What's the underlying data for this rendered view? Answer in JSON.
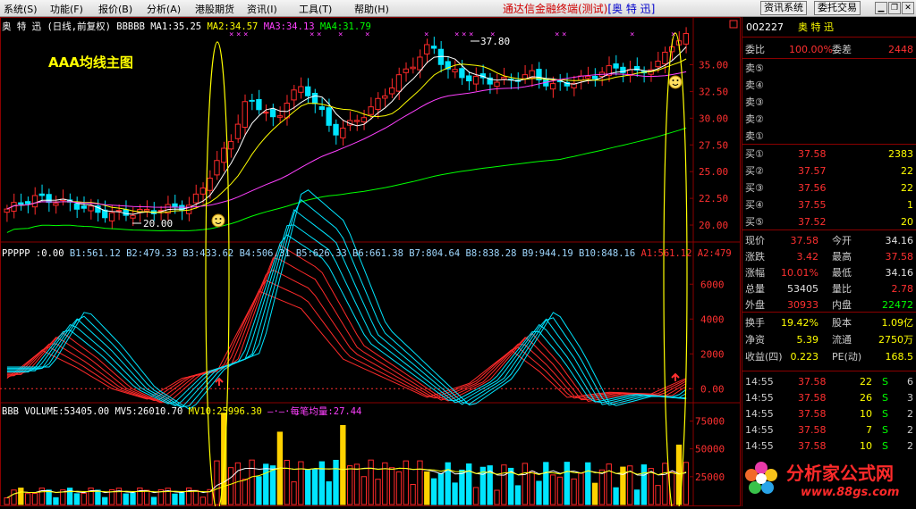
{
  "menubar": {
    "items": [
      "系统(S)",
      "功能(F)",
      "报价(B)",
      "分析(A)",
      "港股期货",
      "资讯(I)",
      "工具(T)",
      "帮助(H)"
    ],
    "app_title": "通达信金融终端(测试)",
    "app_stock": "[奥 特 迅]",
    "btn_news": "资讯系统",
    "btn_trade": "委托交易"
  },
  "main_chart": {
    "header": {
      "name": "奥 特 迅",
      "period": "(日线,前复权)",
      "indicator": "BBBBB",
      "ma1": "MA1:35.25",
      "ma2": "MA2:34.57",
      "ma3": "MA3:34.13",
      "ma4": "MA4:31.79"
    },
    "label": "AAA均线主图",
    "y_ticks": [
      "35.00",
      "32.50",
      "30.00",
      "27.50",
      "25.00",
      "22.50",
      "20.00"
    ],
    "high_label": "37.80",
    "low_label": "20.00",
    "colors": {
      "up": "#ff2a2a",
      "down": "#00e5ff",
      "ma1": "#ffffff",
      "ma2": "#ffff00",
      "ma3": "#ff40ff",
      "ma4": "#00ff00"
    }
  },
  "mid_chart": {
    "header": {
      "title": "PPPPP :0.00",
      "b1": "B1:561.12",
      "b2": "B2:479.33",
      "b3": "B3:433.62",
      "b4": "B4:506.31",
      "b5": "B5:626.33",
      "b6": "B6:661.38",
      "b7": "B7:804.64",
      "b8": "B8:838.28",
      "b9": "B9:944.19",
      "b10": "B10:848.16",
      "a1": "A1:561.12",
      "a2": "A2:479"
    },
    "y_ticks": [
      "6000",
      "4000",
      "2000",
      "0.00"
    ]
  },
  "vol_chart": {
    "header": {
      "title": "BBB VOLUME:53405.00",
      "mv5": "MV5:26010.70",
      "mv10": "MV10:25996.30",
      "avg": "每笔均量:27.44"
    },
    "y_ticks": [
      "75000",
      "50000",
      "25000"
    ]
  },
  "quote": {
    "code": "002227",
    "name": "奥 特 迅",
    "webi_label": "委比",
    "webi_value": "100.00%",
    "weicha_label": "委差",
    "weicha_value": "2448",
    "sells": [
      {
        "label": "卖⑤",
        "price": "",
        "vol": ""
      },
      {
        "label": "卖④",
        "price": "",
        "vol": ""
      },
      {
        "label": "卖③",
        "price": "",
        "vol": ""
      },
      {
        "label": "卖②",
        "price": "",
        "vol": ""
      },
      {
        "label": "卖①",
        "price": "",
        "vol": ""
      }
    ],
    "buys": [
      {
        "label": "买①",
        "price": "37.58",
        "vol": "2383"
      },
      {
        "label": "买②",
        "price": "37.57",
        "vol": "22"
      },
      {
        "label": "买③",
        "price": "37.56",
        "vol": "22"
      },
      {
        "label": "买④",
        "price": "37.55",
        "vol": "1"
      },
      {
        "label": "买⑤",
        "price": "37.52",
        "vol": "20"
      }
    ],
    "stats": [
      {
        "l1": "现价",
        "v1": "37.58",
        "c1": "#ff3030",
        "l2": "今开",
        "v2": "34.16",
        "c2": "#e0e0e0"
      },
      {
        "l1": "涨跌",
        "v1": "3.42",
        "c1": "#ff3030",
        "l2": "最高",
        "v2": "37.58",
        "c2": "#ff3030"
      },
      {
        "l1": "涨幅",
        "v1": "10.01%",
        "c1": "#ff3030",
        "l2": "最低",
        "v2": "34.16",
        "c2": "#e0e0e0"
      },
      {
        "l1": "总量",
        "v1": "53405",
        "c1": "#e0e0e0",
        "l2": "量比",
        "v2": "2.78",
        "c2": "#ff3030"
      },
      {
        "l1": "外盘",
        "v1": "30933",
        "c1": "#ff3030",
        "l2": "内盘",
        "v2": "22472",
        "c2": "#00ff00"
      }
    ],
    "stats2": [
      {
        "l1": "换手",
        "v1": "19.42%",
        "l2": "股本",
        "v2": "1.09亿"
      },
      {
        "l1": "净资",
        "v1": "5.39",
        "l2": "流通",
        "v2": "2750万"
      },
      {
        "l1": "收益(四)",
        "v1": "0.223",
        "l2": "PE(动)",
        "v2": "168.5"
      }
    ],
    "ticks": [
      {
        "time": "14:55",
        "price": "37.58",
        "vol": "22",
        "bs": "S",
        "n": "6"
      },
      {
        "time": "14:55",
        "price": "37.58",
        "vol": "26",
        "bs": "S",
        "n": "3"
      },
      {
        "time": "14:55",
        "price": "37.58",
        "vol": "10",
        "bs": "S",
        "n": "2"
      },
      {
        "time": "14:55",
        "price": "37.58",
        "vol": "7",
        "bs": "S",
        "n": "2"
      },
      {
        "time": "14:55",
        "price": "37.58",
        "vol": "10",
        "bs": "S",
        "n": "2"
      }
    ]
  },
  "logo": {
    "title": "分析家公式网",
    "url": "www.88gs.com"
  }
}
